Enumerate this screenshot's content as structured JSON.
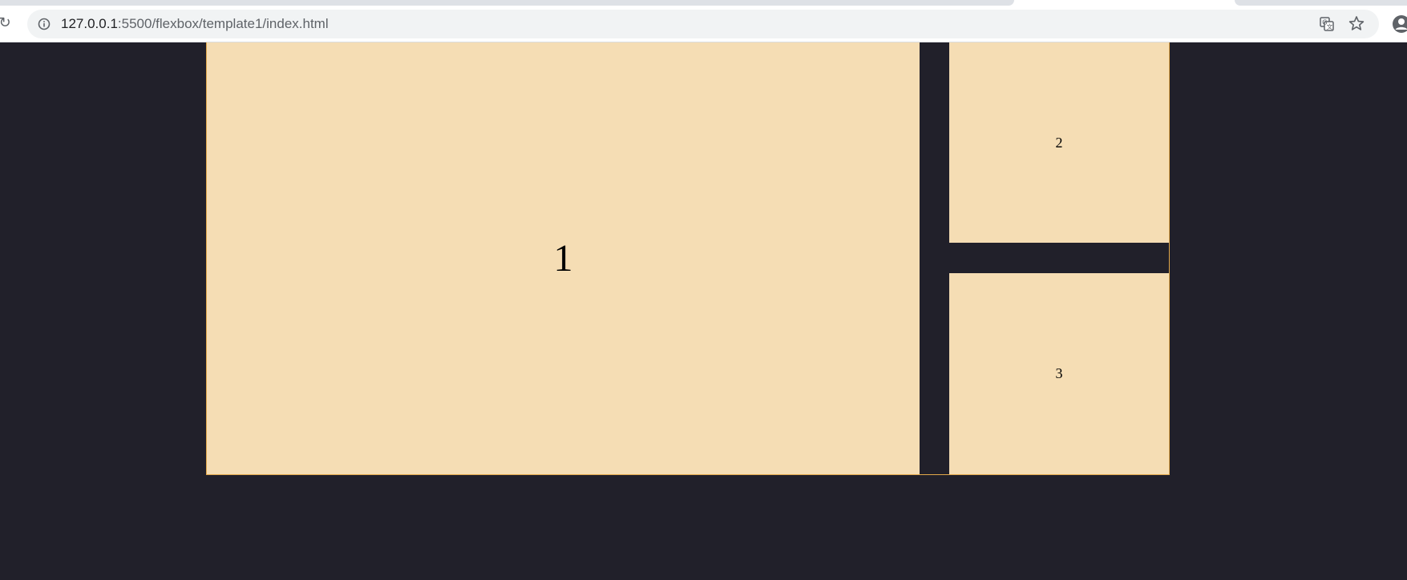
{
  "browser": {
    "url_host": "127.0.0.1",
    "url_path": ":5500/flexbox/template1/index.html",
    "icons": {
      "reload": "reload-icon",
      "site_info": "info-icon",
      "translate": "translate-icon",
      "bookmark": "star-icon",
      "profile": "profile-icon"
    }
  },
  "page": {
    "background_color": "#21202a",
    "box_color": "#f5ddb4",
    "border_color": "#e2a84a",
    "boxes": [
      {
        "label": "1"
      },
      {
        "label": "2"
      },
      {
        "label": "3"
      }
    ]
  }
}
